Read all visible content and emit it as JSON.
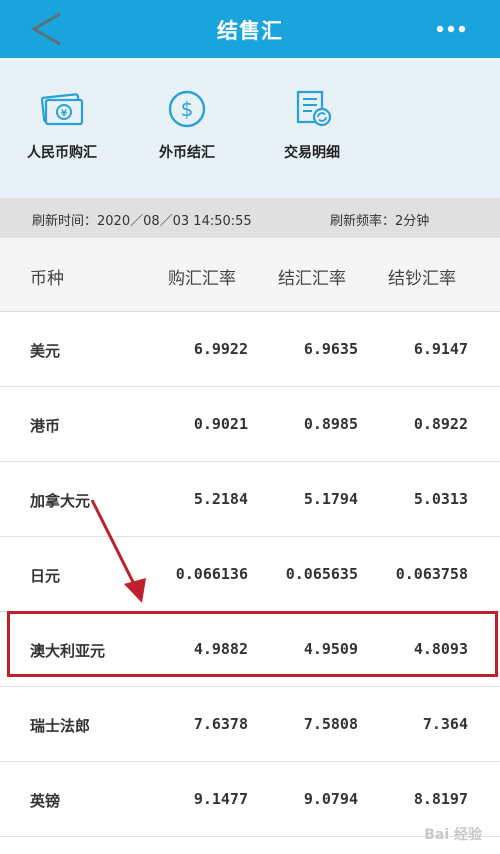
{
  "header": {
    "title": "结售汇"
  },
  "quick_actions": [
    {
      "label": "人民币购汇"
    },
    {
      "label": "外币结汇"
    },
    {
      "label": "交易明细"
    }
  ],
  "refresh": {
    "time_text": "刷新时间：2020／08／03 14:50:55",
    "rate_text": "刷新频率：2分钟"
  },
  "table": {
    "headers": [
      "币种",
      "购汇汇率",
      "结汇汇率",
      "结钞汇率"
    ],
    "rows": [
      {
        "currency": "美元",
        "buy": "6.9922",
        "settle": "6.9635",
        "cash": "6.9147"
      },
      {
        "currency": "港币",
        "buy": "0.9021",
        "settle": "0.8985",
        "cash": "0.8922"
      },
      {
        "currency": "加拿大元",
        "buy": "5.2184",
        "settle": "5.1794",
        "cash": "5.0313"
      },
      {
        "currency": "日元",
        "buy": "0.066136",
        "settle": "0.065635",
        "cash": "0.063758"
      },
      {
        "currency": "澳大利亚元",
        "buy": "4.9882",
        "settle": "4.9509",
        "cash": "4.8093"
      },
      {
        "currency": "瑞士法郎",
        "buy": "7.6378",
        "settle": "7.5808",
        "cash": "7.364"
      },
      {
        "currency": "英镑",
        "buy": "9.1477",
        "settle": "9.0794",
        "cash": "8.8197"
      }
    ]
  },
  "annotation": {
    "highlighted_row": "澳大利亚元",
    "color": "#c0202e"
  },
  "watermark": "Bai 经验",
  "colors": {
    "header_bg": "#1aa4dd",
    "icon_blue": "#2aa0d8",
    "highlight": "#c0202e"
  }
}
